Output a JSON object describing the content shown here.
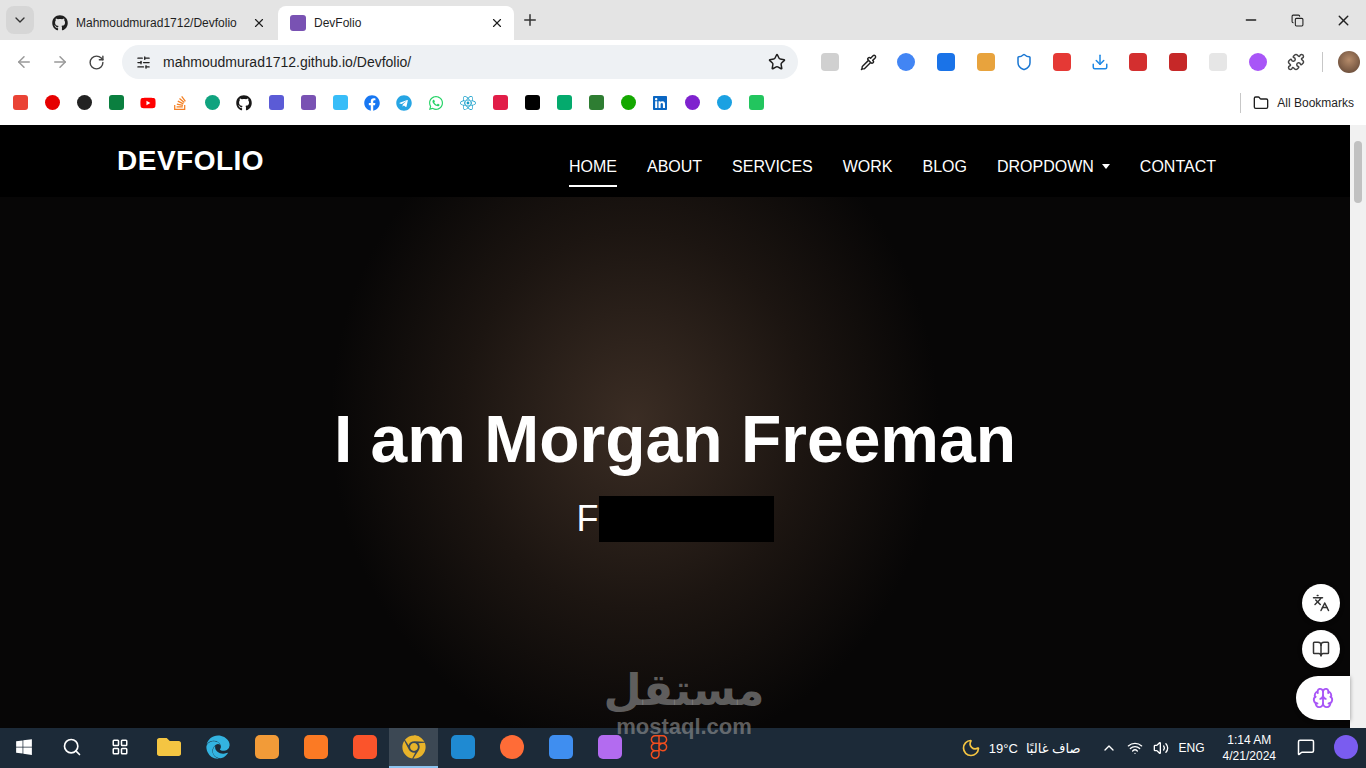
{
  "browser": {
    "tabs": [
      {
        "title": "Mahmoudmurad1712/Devfolio",
        "selected": false
      },
      {
        "title": "DevFolio",
        "selected": true
      }
    ],
    "address": "mahmoudmurad1712.github.io/Devfolio/",
    "bookmarks_folder": "All Bookmarks"
  },
  "site": {
    "brand": "DEVFOLIO",
    "nav": [
      {
        "label": "HOME",
        "selected": true,
        "kind": "link"
      },
      {
        "label": "ABOUT",
        "selected": false,
        "kind": "link"
      },
      {
        "label": "SERVICES",
        "selected": false,
        "kind": "link"
      },
      {
        "label": "WORK",
        "selected": false,
        "kind": "link"
      },
      {
        "label": "BLOG",
        "selected": false,
        "kind": "link"
      },
      {
        "label": "DROPDOWN",
        "selected": false,
        "kind": "dropdown"
      },
      {
        "label": "CONTACT",
        "selected": false,
        "kind": "link"
      }
    ],
    "hero": {
      "title": "I am Morgan Freeman",
      "typed": "F"
    }
  },
  "watermark": {
    "arabic": "مستقل",
    "latin": "mostaql.com"
  },
  "taskbar": {
    "weather": {
      "temp": "19°C",
      "text": "صاف غالبًا"
    },
    "language": "ENG",
    "time": "1:14 AM",
    "date": "4/21/2024"
  }
}
